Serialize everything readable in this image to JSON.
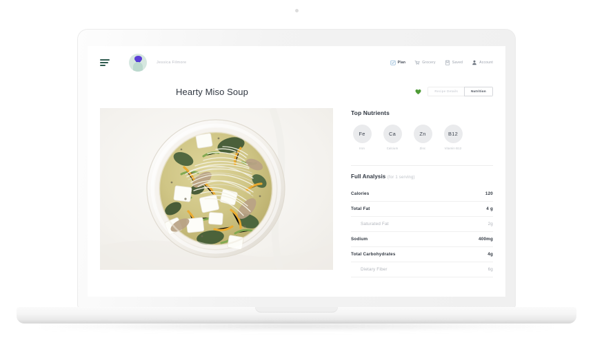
{
  "device": {
    "type": "laptop-mockup",
    "camera": "camera-dot"
  },
  "header": {
    "menu_icon": "hamburger-menu-icon",
    "avatar_icon": "user-avatar",
    "user_name": "Jessica Filmore",
    "nav": [
      {
        "label": "Plan",
        "icon": "calendar-check-icon",
        "active": true
      },
      {
        "label": "Grocery",
        "icon": "shopping-cart-icon",
        "active": false
      },
      {
        "label": "Saved",
        "icon": "bookmark-icon",
        "active": false
      },
      {
        "label": "Account",
        "icon": "person-icon",
        "active": false
      }
    ]
  },
  "title_row": {
    "recipe_title": "Hearty Miso Soup",
    "favorite_icon": "heart-icon",
    "favorite_color": "#4f9b37",
    "tabs": [
      {
        "label": "Recipe Details",
        "active": false
      },
      {
        "label": "Nutrition",
        "active": true
      }
    ]
  },
  "photo": {
    "alt": "miso-soup-bowl-photo"
  },
  "nutrients": {
    "section_title": "Top Nutrients",
    "items": [
      {
        "symbol": "Fe",
        "label": "Iron"
      },
      {
        "symbol": "Ca",
        "label": "Calcium"
      },
      {
        "symbol": "Zn",
        "label": "Zinc"
      },
      {
        "symbol": "B12",
        "label": "Vitamin B12"
      }
    ]
  },
  "analysis": {
    "title": "Full Analysis",
    "subtitle": "(for 1 serving)",
    "rows": [
      {
        "label": "Calories",
        "value": "120",
        "sub": false
      },
      {
        "label": "Total Fat",
        "value": "4 g",
        "sub": false
      },
      {
        "label": "Saturated Fat",
        "value": "2g",
        "sub": true
      },
      {
        "label": "Sodium",
        "value": "400mg",
        "sub": false
      },
      {
        "label": "Total Carbohydrates",
        "value": "4g",
        "sub": false
      },
      {
        "label": "Dietary Fiber",
        "value": "6g",
        "sub": true
      }
    ]
  }
}
